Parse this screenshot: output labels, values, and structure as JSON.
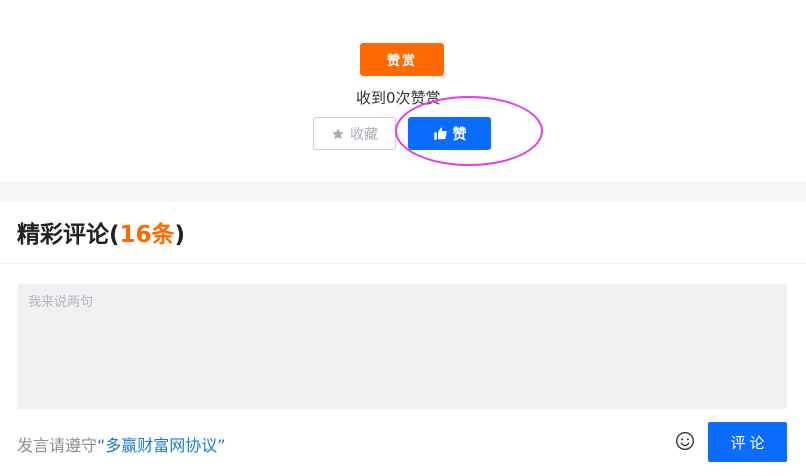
{
  "reward": {
    "button_label": "赞赏",
    "count_text": "收到0次赞赏"
  },
  "actions": {
    "favorite_label": "收藏",
    "favorite_icon": "star-icon",
    "like_label": "赞",
    "like_icon": "thumbs-up-icon"
  },
  "comments": {
    "title_prefix": "精彩评论(",
    "title_count": "16条",
    "title_suffix": ")",
    "input_placeholder": "我来说两句",
    "agreement_prefix": "发言请遵守",
    "agreement_link": "“多赢财富网协议”",
    "emoji_icon": "smiley-icon",
    "submit_label": "评论"
  },
  "colors": {
    "accent_orange": "#ff6a00",
    "accent_blue": "#0c6cff",
    "annotation_magenta": "#e43ce8"
  }
}
